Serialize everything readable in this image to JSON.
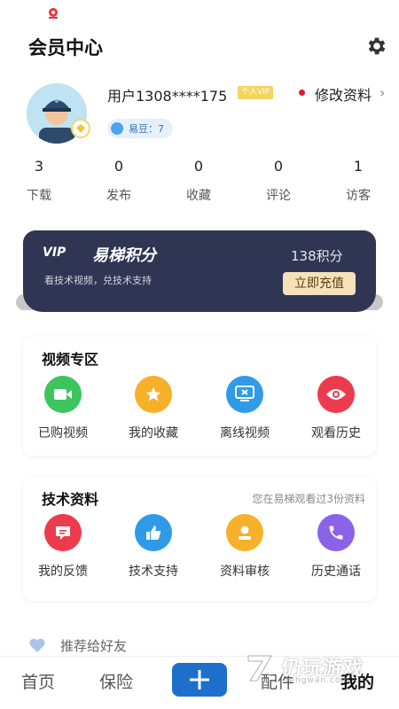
{
  "header": {
    "title": "会员中心"
  },
  "profile": {
    "username": "用户1308****175",
    "vip_tag": "个人VIP",
    "edit_label": "修改资料",
    "beans_label": "易豆：7"
  },
  "stats": [
    {
      "value": "3",
      "label": "下载"
    },
    {
      "value": "0",
      "label": "发布"
    },
    {
      "value": "0",
      "label": "收藏"
    },
    {
      "value": "0",
      "label": "评论"
    },
    {
      "value": "1",
      "label": "访客"
    }
  ],
  "points_card": {
    "logo": "VIP",
    "title": "易梯积分",
    "subtitle": "看技术视频，兑技术支持",
    "value": "138积分",
    "button": "立即充值"
  },
  "video_section": {
    "title": "视频专区",
    "items": [
      {
        "label": "已购视频",
        "icon": "video-camera-icon",
        "color": "#3cc55d"
      },
      {
        "label": "我的收藏",
        "icon": "star-icon",
        "color": "#f6b02a"
      },
      {
        "label": "离线视频",
        "icon": "monitor-icon",
        "color": "#2f9ae8"
      },
      {
        "label": "观看历史",
        "icon": "eye-icon",
        "color": "#ec3b4d"
      }
    ]
  },
  "tech_section": {
    "title": "技术资料",
    "note": "您在易梯观看过3份资料",
    "items": [
      {
        "label": "我的反馈",
        "icon": "message-icon",
        "color": "#ec3b4d"
      },
      {
        "label": "技术支持",
        "icon": "thumbs-up-icon",
        "color": "#2f9ae8"
      },
      {
        "label": "资料审核",
        "icon": "person-icon",
        "color": "#f6b02a"
      },
      {
        "label": "历史通话",
        "icon": "phone-icon",
        "color": "#8a63e8"
      }
    ]
  },
  "recommend": {
    "label": "推荐给好友"
  },
  "bottom_nav": {
    "items": [
      "首页",
      "保险",
      "配件",
      "我的"
    ],
    "active_index": 3
  },
  "watermark": {
    "text": "仍玩游戏",
    "sub": "rengwan.com"
  }
}
